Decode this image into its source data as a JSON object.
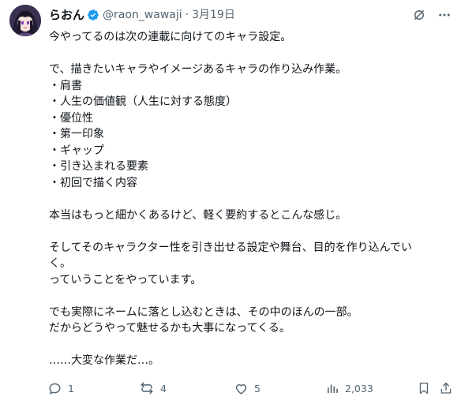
{
  "author": {
    "name": "らおん",
    "handle": "@raon_wawaji",
    "date": "3月19日"
  },
  "icons": {
    "avatar": "avatar",
    "verified": "verified-badge-icon",
    "grok": "grok-icon",
    "more": "more-icon",
    "reply": "reply-icon",
    "retweet": "retweet-icon",
    "like": "like-icon",
    "views": "views-icon",
    "bookmark": "bookmark-icon",
    "share": "share-icon"
  },
  "colors": {
    "text": "#0f1419",
    "muted": "#536471",
    "verified": "#1d9bf0"
  },
  "tweet": {
    "lines": [
      "今やってるのは次の連載に向けてのキャラ設定。",
      "",
      "で、描きたいキャラやイメージあるキャラの作り込み作業。",
      "・肩書",
      "・人生の価値観（人生に対する態度）",
      "・優位性",
      "・第一印象",
      "・ギャップ",
      "・引き込まれる要素",
      "・初回で描く内容",
      "",
      "本当はもっと細かくあるけど、軽く要約するとこんな感じ。",
      "",
      "そしてそのキャラクター性を引き出せる設定や舞台、目的を作り込んでい",
      "く。",
      "っていうことをやっています。",
      "",
      "でも実際にネームに落とし込むときは、その中のほんの一部。",
      "だからどうやって魅せるかも大事になってくる。",
      "",
      "……大変な作業だ…。"
    ]
  },
  "stats": {
    "replies": "1",
    "retweets": "4",
    "likes": "5",
    "views": "2,033"
  }
}
